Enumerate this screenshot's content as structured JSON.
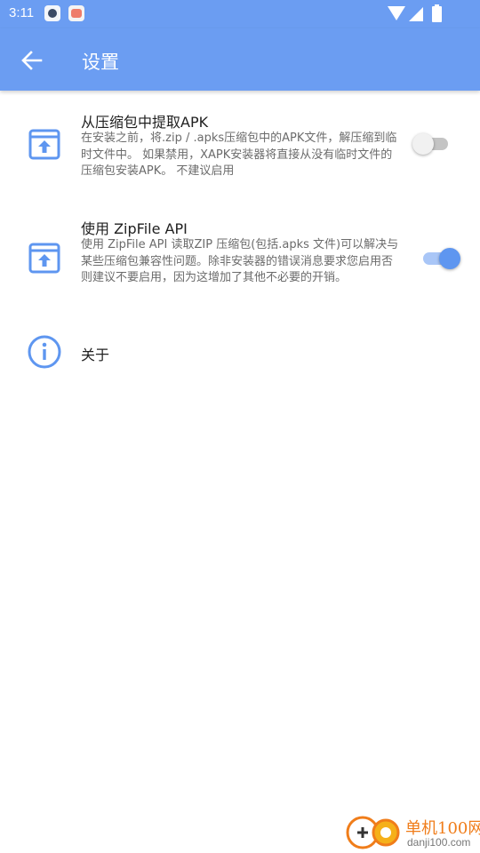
{
  "status_bar": {
    "time": "3:11",
    "notification_icons": [
      "app-notification-icon",
      "health-app-icon"
    ],
    "indicators": [
      "wifi-icon",
      "signal-icon",
      "battery-charging-icon"
    ]
  },
  "toolbar": {
    "back_icon": "arrow-left-icon",
    "title": "设置"
  },
  "settings": [
    {
      "icon": "archive-upload-icon",
      "title": "从压缩包中提取APK",
      "description": "在安装之前，将.zip / .apks压缩包中的APK文件，解压缩到临时文件中。 如果禁用，XAPK安装器将直接从没有临时文件的压缩包安装APK。 不建议启用",
      "enabled": false
    },
    {
      "icon": "archive-upload-icon",
      "title": "使用 ZipFile API",
      "description": "使用 ZipFile API 读取ZIP 压缩包(包括.apks 文件)可以解决与某些压缩包兼容性问题。除非安装器的错误消息要求您启用否则建议不要启用，因为这增加了其他不必要的开销。",
      "enabled": true
    },
    {
      "icon": "info-circle-icon",
      "title": "关于"
    }
  ],
  "watermark": {
    "line1": "单机100网",
    "line2": "danji100.com"
  },
  "colors": {
    "primary": "#6b9df2",
    "icon": "#5e96f0",
    "switch_on": "#5e96f0",
    "switch_off": "#f1f1f1"
  }
}
